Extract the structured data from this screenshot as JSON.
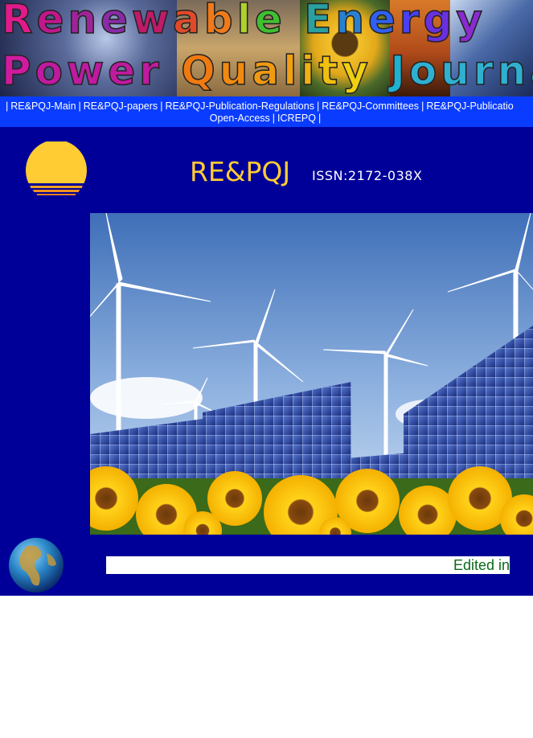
{
  "banner": {
    "line1": "Renewable Energy",
    "line2": "Power Quality Journal",
    "line1_colors": [
      "#e01a8a",
      "#c0188c",
      "#a0239a",
      "#8a2aa8",
      "#c01a6a",
      "#e04a2a",
      "#f07a1a",
      "#b0d02a",
      "#40c030",
      "#30b070",
      "#2aa0a0",
      "#2a80d0",
      "#3060f0",
      "#4a40f0",
      "#6a30e0",
      "#8a2ad0"
    ],
    "line2_colors": [
      "#d01aa0",
      "#c01aa0",
      "#c01aa0",
      "#c01aa0",
      "#c01aa0",
      "#ffffff",
      "#f07a10",
      "#f08a10",
      "#f09a10",
      "#f0a010",
      "#f0b010",
      "#f0c010",
      "#f0d010",
      "#ffffff",
      "#20b0d0",
      "#30b0d0",
      "#30b0d0",
      "#30b0d0",
      "#30b0d0",
      "#30b0d0",
      "#30b0d0"
    ]
  },
  "nav": {
    "row1": [
      {
        "label": "RE&PQJ-Main",
        "name": "nav-link-main"
      },
      {
        "label": "RE&PQJ-papers",
        "name": "nav-link-papers"
      },
      {
        "label": "RE&PQJ-Publication-Regulations",
        "name": "nav-link-publication-regulations"
      },
      {
        "label": "RE&PQJ-Committees",
        "name": "nav-link-committees"
      },
      {
        "label": "RE&PQJ-Publicatio",
        "name": "nav-link-publication-cut"
      }
    ],
    "row2": [
      {
        "label": "Open-Access",
        "name": "nav-link-open-access"
      },
      {
        "label": "ICREPQ",
        "name": "nav-link-icrepq"
      }
    ],
    "separator": "|"
  },
  "header": {
    "journal_abbr": "RE&PQJ",
    "issn": "ISSN:2172-038X"
  },
  "marquee": {
    "text": "Edited in"
  },
  "colors": {
    "main_bg": "#000099",
    "nav_bg": "#0a3cff",
    "accent_yellow": "#ffcc33",
    "marquee_text": "#0a6a1a"
  },
  "icons": {
    "logo": "sun-logo-icon",
    "globe": "globe-icon"
  }
}
